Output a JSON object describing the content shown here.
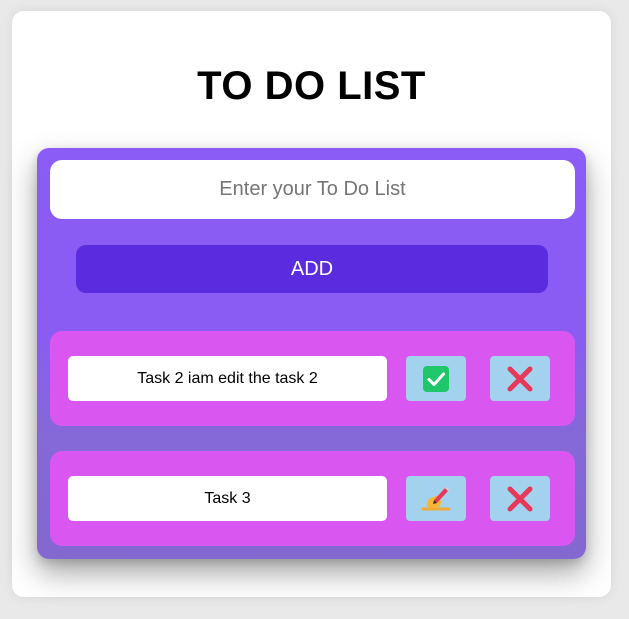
{
  "app": {
    "title": "TO DO LIST"
  },
  "input": {
    "placeholder": "Enter your To Do List",
    "value": ""
  },
  "add_button": {
    "label": "ADD"
  },
  "tasks": [
    {
      "text": "Task 2 iam edit the task 2",
      "action_icon": "check-mark-icon",
      "delete_icon": "cross-mark-icon"
    },
    {
      "text": "Task 3",
      "action_icon": "writing-hand-icon",
      "delete_icon": "cross-mark-icon"
    }
  ],
  "colors": {
    "panel": "#8b5cf6",
    "add_button": "#5b2be0",
    "task_row": "#d957f0",
    "icon_button": "#a3d2ee",
    "check_green": "#1fc76a",
    "cross_red": "#e8385a"
  }
}
